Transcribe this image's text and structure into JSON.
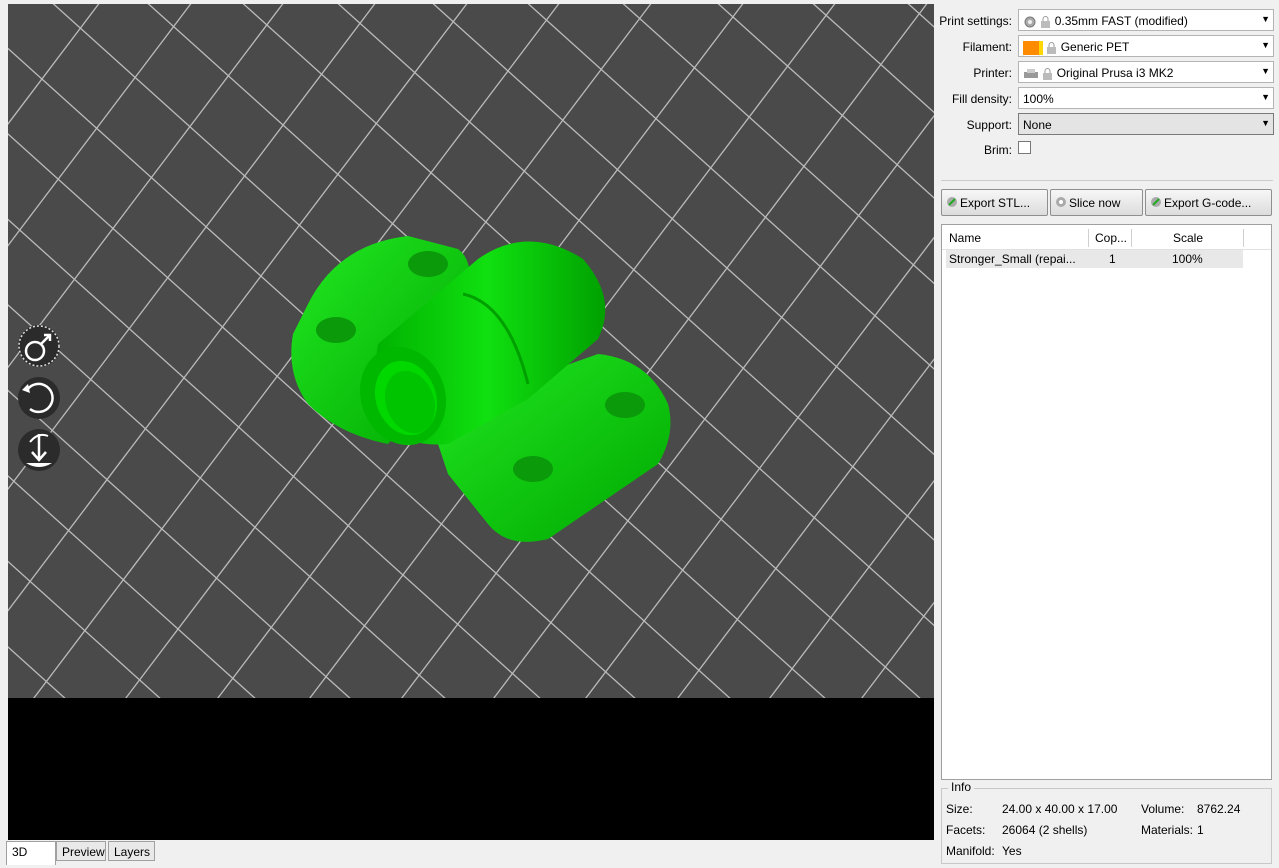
{
  "tabs": [
    "3D",
    "Preview",
    "Layers"
  ],
  "settings": {
    "print": {
      "label": "Print settings:",
      "value": "0.35mm FAST (modified)"
    },
    "filament": {
      "label": "Filament:",
      "value": "Generic PET",
      "color": "#ff8c00"
    },
    "printer": {
      "label": "Printer:",
      "value": "Original Prusa i3 MK2"
    },
    "fill": {
      "label": "Fill density:",
      "value": "100%"
    },
    "support": {
      "label": "Support:",
      "value": "None"
    },
    "brim": {
      "label": "Brim:",
      "checked": false
    }
  },
  "buttons": {
    "export_stl": "Export STL...",
    "slice_now": "Slice now",
    "export_gcode": "Export G-code..."
  },
  "object_list": {
    "columns": [
      "Name",
      "Cop...",
      "Scale"
    ],
    "rows": [
      {
        "name": "Stronger_Small (repai...",
        "copies": "1",
        "scale": "100%"
      }
    ]
  },
  "info": {
    "title": "Info",
    "size_label": "Size:",
    "size": "24.00 x 40.00 x 17.00",
    "volume_label": "Volume:",
    "volume": "8762.24",
    "facets_label": "Facets:",
    "facets": "26064 (2 shells)",
    "materials_label": "Materials:",
    "materials": "1",
    "manifold_label": "Manifold:",
    "manifold": "Yes"
  },
  "viewport_tools": [
    "scale-tool-icon",
    "rotate-tool-icon",
    "lay-flat-tool-icon"
  ],
  "colors": {
    "model": "#00cc00",
    "bed": "#4a4a4a"
  }
}
